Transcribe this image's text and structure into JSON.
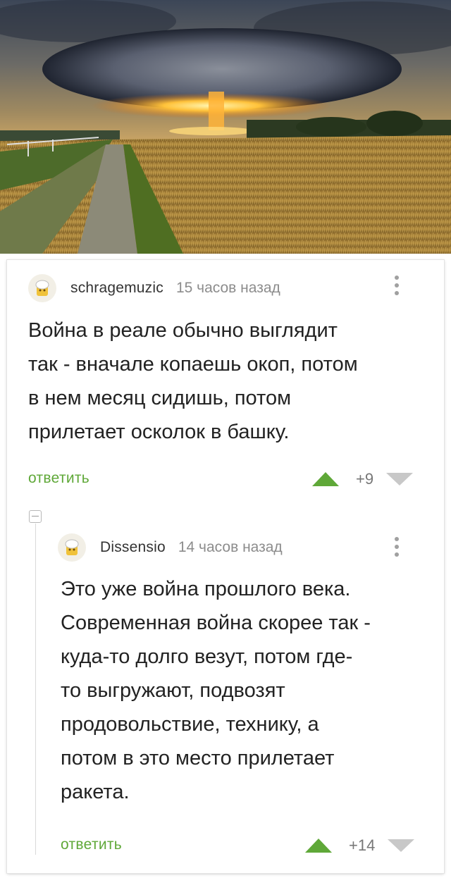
{
  "comments": [
    {
      "author": "schragemuzic",
      "time": "15 часов назад",
      "lines": [
        "Война в реале обычно выглядит",
        "так - вначале копаешь окоп, потом",
        "в нем месяц сидишь, потом",
        "прилетает осколок в башку."
      ],
      "reply_label": "ответить",
      "score": "+9"
    },
    {
      "author": "Dissensio",
      "time": "14 часов назад",
      "lines": [
        "Это уже война прошлого века.",
        "Современная война скорее так -",
        "куда-то долго везут, потом где-",
        "то выгружают, подвозят",
        "продовольствие, технику, а",
        "потом в это место прилетает",
        "ракета."
      ],
      "reply_label": "ответить",
      "score": "+14"
    }
  ],
  "colors": {
    "accent": "#5fa838",
    "downvote": "#c8c8c8",
    "text": "#222222",
    "muted": "#8c8c8c"
  },
  "icons": [
    "avatar-icon",
    "more-icon",
    "upvote-icon",
    "downvote-icon",
    "collapse-icon"
  ]
}
